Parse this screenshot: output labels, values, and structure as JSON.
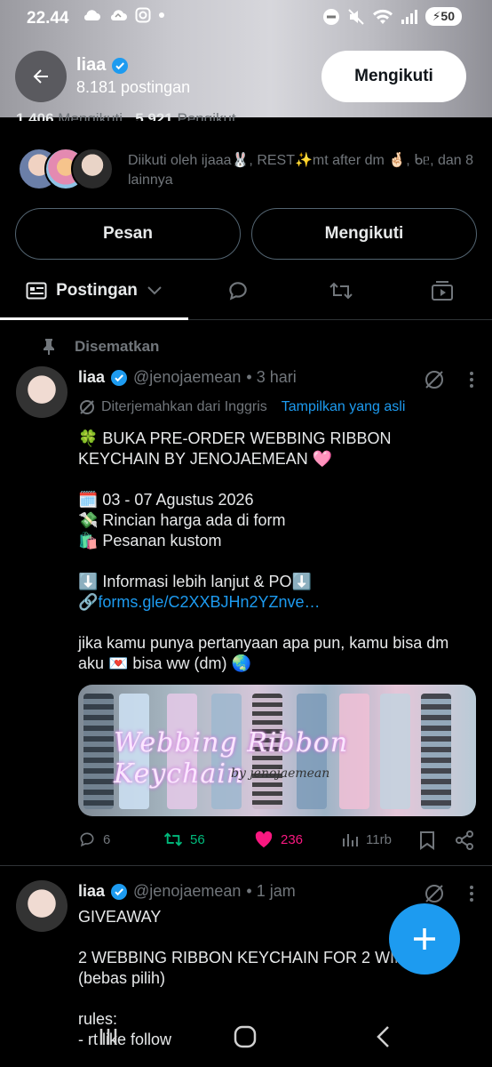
{
  "status": {
    "time": "22.44",
    "battery": "50"
  },
  "header": {
    "name": "liaa",
    "post_count": "8.181 postingan",
    "follow_label": "Mengikuti"
  },
  "profile": {
    "following_count": "1.406",
    "following_label": "Mengikuti",
    "followers_count": "5.921",
    "followers_label": "Pengikut",
    "followed_by": "Diikuti oleh ijaaa🐰, REST✨mt after dm 🤞🏻, ᑲᥱ, dan 8 lainnya",
    "message_label": "Pesan",
    "follow_label": "Mengikuti"
  },
  "tabs": {
    "active_label": "Postingan"
  },
  "pinned_label": "Disematkan",
  "post1": {
    "name": "liaa",
    "handle": "@jenojaemean",
    "time": "• 3 hari",
    "translated_label": "Diterjemahkan dari Inggris",
    "show_original": "Tampilkan yang asli",
    "text_top": "🍀 BUKA PRE-ORDER WEBBING RIBBON KEYCHAIN BY JENOJAEMEAN 🩷\n\n🗓️ 03 - 07 Agustus 2026\n💸 Rincian harga ada di form\n🛍️ Pesanan kustom\n\n⬇️ Informasi lebih lanjut & PO⬇️\n🔗",
    "link": "forms.gle/C2XXBJHn2YZnve…",
    "text_bottom": "\n\njika kamu punya pertanyaan apa pun, kamu bisa dm aku 💌 bisa ww (dm) 🌏",
    "media_title": "Webbing Ribbon Keychain",
    "media_sub": "by jenojaemean",
    "replies": "6",
    "reposts": "56",
    "likes": "236",
    "views": "11rb"
  },
  "post2": {
    "name": "liaa",
    "handle": "@jenojaemean",
    "time": "• 1 jam",
    "text": "GIVEAWAY\n\n2 WEBBING RIBBON KEYCHAIN FOR 2 WIN\n(bebas pilih)\n\nrules:\n- rt like follow"
  },
  "colors": {
    "accent": "#1d9bf0",
    "repost": "#00ba7c",
    "like": "#f91880",
    "verified": "#1d9bf0"
  }
}
